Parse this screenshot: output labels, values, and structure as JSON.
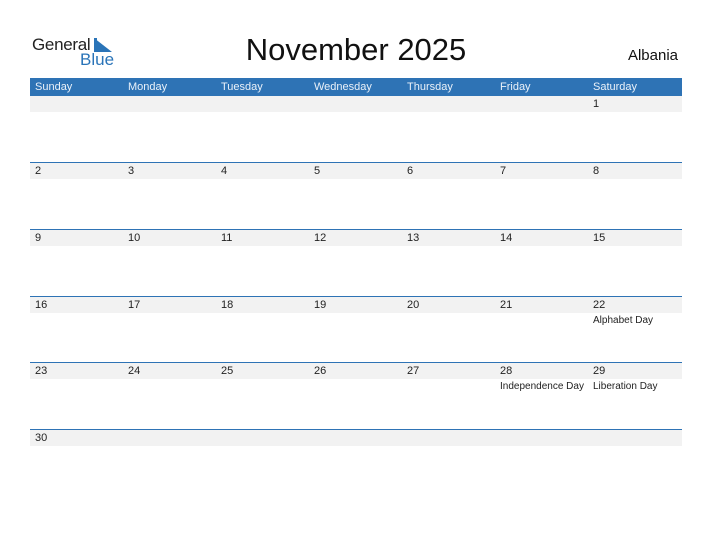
{
  "logo": {
    "general": "General",
    "blue": "Blue"
  },
  "title": "November 2025",
  "country": "Albania",
  "weekdays": [
    "Sunday",
    "Monday",
    "Tuesday",
    "Wednesday",
    "Thursday",
    "Friday",
    "Saturday"
  ],
  "weeks": [
    [
      {
        "d": ""
      },
      {
        "d": ""
      },
      {
        "d": ""
      },
      {
        "d": ""
      },
      {
        "d": ""
      },
      {
        "d": ""
      },
      {
        "d": "1"
      }
    ],
    [
      {
        "d": "2"
      },
      {
        "d": "3"
      },
      {
        "d": "4"
      },
      {
        "d": "5"
      },
      {
        "d": "6"
      },
      {
        "d": "7"
      },
      {
        "d": "8"
      }
    ],
    [
      {
        "d": "9"
      },
      {
        "d": "10"
      },
      {
        "d": "11"
      },
      {
        "d": "12"
      },
      {
        "d": "13"
      },
      {
        "d": "14"
      },
      {
        "d": "15"
      }
    ],
    [
      {
        "d": "16"
      },
      {
        "d": "17"
      },
      {
        "d": "18"
      },
      {
        "d": "19"
      },
      {
        "d": "20"
      },
      {
        "d": "21"
      },
      {
        "d": "22",
        "e": "Alphabet Day"
      }
    ],
    [
      {
        "d": "23"
      },
      {
        "d": "24"
      },
      {
        "d": "25"
      },
      {
        "d": "26"
      },
      {
        "d": "27"
      },
      {
        "d": "28",
        "e": "Independence Day"
      },
      {
        "d": "29",
        "e": "Liberation Day"
      }
    ],
    [
      {
        "d": "30"
      },
      {
        "d": ""
      },
      {
        "d": ""
      },
      {
        "d": ""
      },
      {
        "d": ""
      },
      {
        "d": ""
      },
      {
        "d": ""
      }
    ]
  ]
}
